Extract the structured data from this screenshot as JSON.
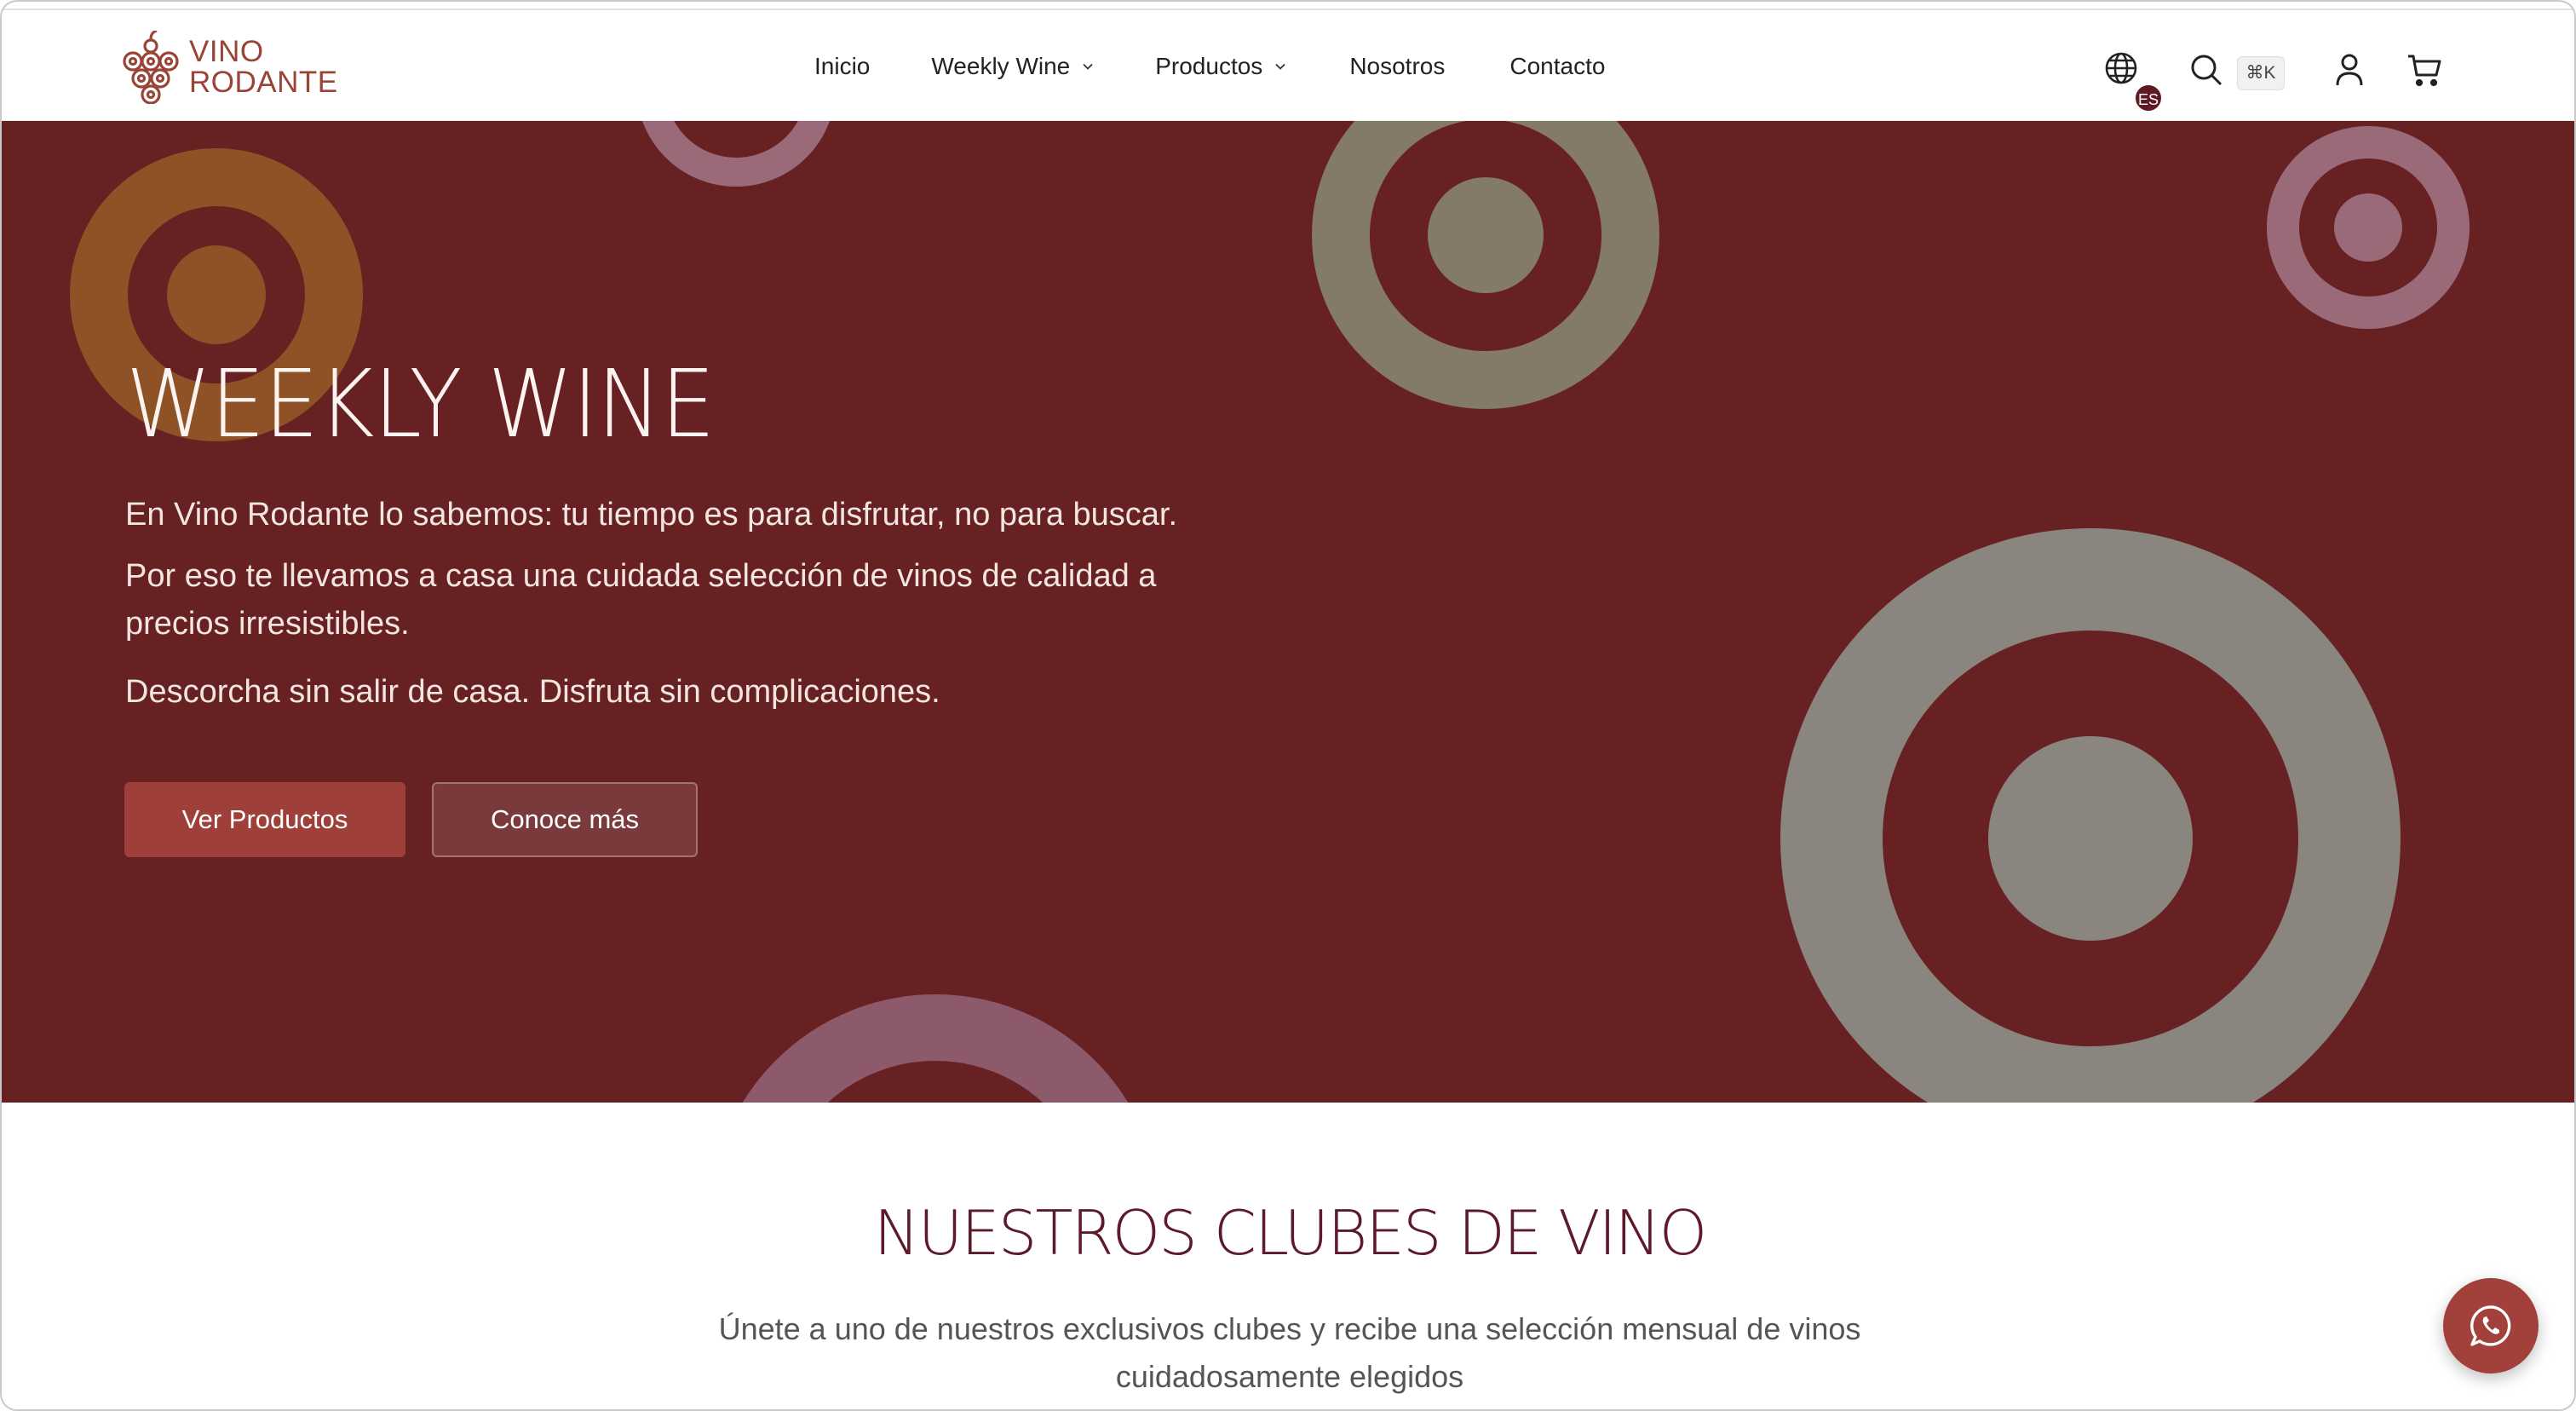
{
  "brand": {
    "logo_line1": "VINO",
    "logo_line2": "RODANTE",
    "accent": "#9a4437"
  },
  "nav": {
    "items": [
      {
        "label": "Inicio",
        "has_dropdown": false
      },
      {
        "label": "Weekly Wine",
        "has_dropdown": true
      },
      {
        "label": "Productos",
        "has_dropdown": true
      },
      {
        "label": "Nosotros",
        "has_dropdown": false
      },
      {
        "label": "Contacto",
        "has_dropdown": false
      }
    ]
  },
  "header_actions": {
    "language_icon": "globe-icon",
    "language_code": "ES",
    "search_icon": "search-icon",
    "search_shortcut": "⌘K",
    "account_icon": "user-icon",
    "cart_icon": "cart-icon"
  },
  "hero": {
    "background": "#682123",
    "title": "WEEKLY WINE",
    "paragraph_1": "En Vino Rodante lo sabemos: tu tiempo es para disfrutar, no para buscar.",
    "paragraph_2": "Por eso te llevamos a casa una cuidada selección de vinos de calidad a precios irresistibles.",
    "paragraph_3": "Descorcha sin salir de casa. Disfruta sin complicaciones.",
    "primary_button": "Ver Productos",
    "secondary_button": "Conoce más"
  },
  "clubs": {
    "title": "NUESTROS CLUBES DE VINO",
    "subtitle": "Únete a uno de nuestros exclusivos clubes y recibe una selección mensual de vinos cuidadosamente elegidos"
  },
  "floating": {
    "icon": "whatsapp-icon",
    "color": "#a2413b"
  }
}
